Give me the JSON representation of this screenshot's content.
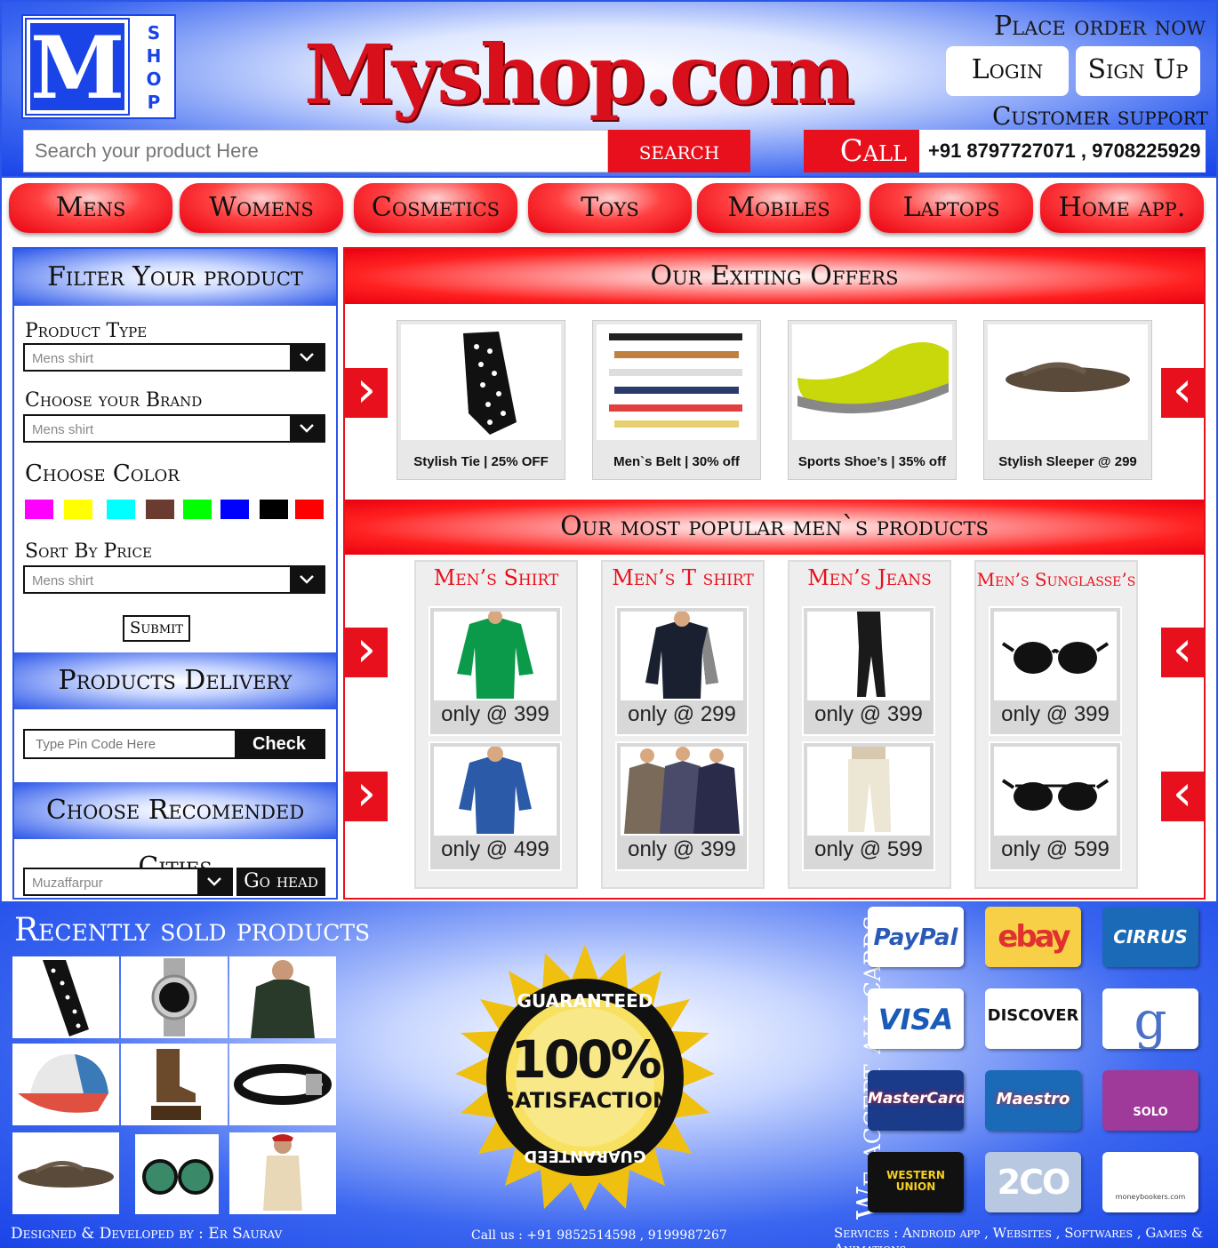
{
  "header": {
    "logo_letter": "M",
    "logo_shop": [
      "S",
      "H",
      "O",
      "P"
    ],
    "brand": "Myshop.com",
    "place_order": "Place order now",
    "login": "Login",
    "signup": "Sign Up",
    "customer_support": "Customer support",
    "search_placeholder": "Search your product Here",
    "search_button": "search",
    "call_button": "Call",
    "phones": "+91 8797727071 ,  9708225929"
  },
  "nav": [
    "Mens",
    "Womens",
    "Cosmetics",
    "Toys",
    "Mobiles",
    "Laptops",
    "Home app."
  ],
  "sidebar": {
    "filter_title": "Filter Your product",
    "product_type_label": "Product Type",
    "product_type_value": "Mens shirt",
    "brand_label": "Choose your Brand",
    "brand_value": "Mens shirt",
    "color_label": "Choose Color",
    "colors": [
      "#ff00ff",
      "#ffff00",
      "#00ffff",
      "#6b3a30",
      "#00ff00",
      "#0000ff",
      "#000000",
      "#ff0000"
    ],
    "sort_label": "Sort By Price",
    "sort_value": "Mens shirt",
    "submit": "Submit",
    "delivery_title": "Products Delivery",
    "pin_placeholder": "Type Pin Code Here",
    "check": "Check",
    "cities_title": "Choose Recomended Cities",
    "city_value": "Muzaffarpur",
    "go_head": "Go head"
  },
  "offers": {
    "title": "Our Exiting Offers",
    "items": [
      {
        "caption": "Stylish Tie | 25% OFF",
        "icon": "tie"
      },
      {
        "caption": "Men`s Belt | 30% off",
        "icon": "belts"
      },
      {
        "caption": "Sports Shoe’s | 35% off",
        "icon": "shoe"
      },
      {
        "caption": "Stylish Sleeper @ 299",
        "icon": "sandal"
      }
    ]
  },
  "popular": {
    "title": "Our most popular men`s products",
    "columns": [
      {
        "title": "Men’s Shirt",
        "prices": [
          "only @ 399",
          "only @ 499"
        ]
      },
      {
        "title": "Men’s T shirt",
        "prices": [
          "only @ 299",
          "only @ 399"
        ]
      },
      {
        "title": "Men’s Jeans",
        "prices": [
          "only @ 399",
          "only @ 599"
        ]
      },
      {
        "title": "Men’s Sunglasse’s",
        "prices": [
          "only @ 399",
          "only @ 599"
        ]
      }
    ]
  },
  "footer": {
    "recent_title": "Recently sold products",
    "seal_top": "GUARANTEED",
    "seal_percent": "100%",
    "seal_text": "SATISFACTION",
    "seal_bottom": "GUARANTEED",
    "accept": "We accept all cards",
    "cards": [
      "PayPal",
      "ebay",
      "CIRRUS",
      "VISA",
      "DISCOVER",
      "g",
      "MasterCard",
      "Maestro",
      "SOLO",
      "WESTERN UNION",
      "2CO",
      "moneybookers.com"
    ],
    "credit": "Designed & Developed by : Er Saurav",
    "call_us": "Call us : +91 9852514598 , 9199987267",
    "services": "Services : Android app , Websites , Softwares , Games & Animations"
  }
}
